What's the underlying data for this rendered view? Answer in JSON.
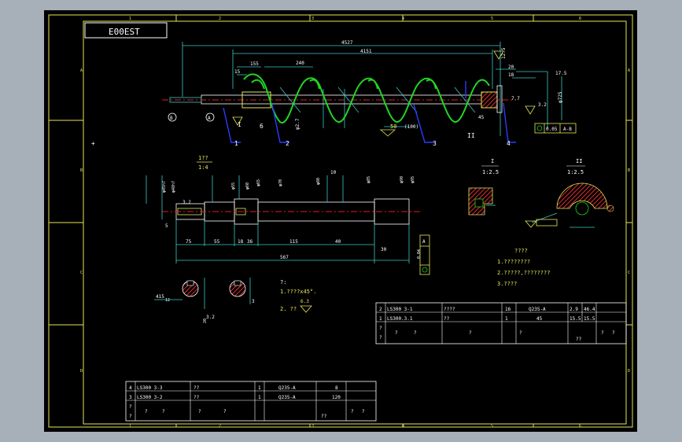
{
  "title_box": "E00EST",
  "border": {
    "top_numbers": [
      "1",
      "2",
      "3",
      "4",
      "5",
      "6"
    ],
    "bottom_numbers": [
      "1",
      "2",
      "3",
      "4",
      "5",
      "6"
    ],
    "left_letters": [
      "A",
      "B",
      "C",
      "D"
    ],
    "right_letters": [
      "A",
      "B",
      "C",
      "D"
    ]
  },
  "main_view": {
    "dims": [
      "4527",
      "4151",
      "155",
      "240",
      "15",
      "20",
      "12.5",
      "18",
      "17.5",
      "7.7",
      "3.2",
      "45",
      "φ725",
      "φ2.7"
    ],
    "labels": {
      "b": "B",
      "a": "A"
    },
    "callouts": [
      "1",
      "2",
      "3",
      "4",
      "I",
      "II",
      "6"
    ],
    "pitch": "50",
    "pitch_n": "(100)",
    "tol_value": "0.05",
    "tol_ref": "A-B"
  },
  "shaft_detail": {
    "scale_top": "1??",
    "scale_bottom": "1:4",
    "dims": [
      "75",
      "55",
      "18",
      "36",
      "115",
      "567",
      "10",
      "40",
      "30",
      "5",
      "3.2"
    ],
    "tol_value": "0.04",
    "tol_ref": "A"
  },
  "section_views": {
    "section_i_label": "I",
    "section_i_scale": "1:2.5",
    "section_ii_label": "II",
    "section_ii_scale": "1:2.5"
  },
  "small_sections": {
    "dims": [
      "415",
      "12",
      "3.2",
      "3",
      "20"
    ]
  },
  "notes_left": {
    "title": "?:",
    "line1": "1.????x45°.",
    "roughness": "6.3",
    "line2": "2. ??"
  },
  "notes_right": {
    "title": "????",
    "line1": "1.????????",
    "line2": "2.?????,????????",
    "line3": "3.????"
  },
  "bom_right": {
    "rows": [
      [
        "2",
        "LS300 3-1",
        "????",
        "16",
        "Q235-A",
        "2.9",
        "46.4"
      ],
      [
        "1",
        "LS300.3.1",
        "??",
        "1",
        "45",
        "15.5",
        "15.5"
      ],
      [
        "?",
        "?",
        "?",
        "?",
        "?",
        "?",
        "??",
        "?",
        "?"
      ]
    ]
  },
  "bom_left": {
    "rows": [
      [
        "4",
        "LS300 3-3",
        "??",
        "1",
        "Q235-A",
        "8"
      ],
      [
        "3",
        "LS300 3-2",
        "??",
        "1",
        "Q235-A",
        "120"
      ],
      [
        "?",
        "?",
        "?",
        "?",
        "?",
        "?",
        "??",
        "?",
        "?"
      ]
    ]
  },
  "colors": {
    "background": "#000000",
    "frame": "#e6e65a",
    "dimension": "#3cc8c8",
    "text": "#ffffff",
    "outline": "#ffffff",
    "spiral": "#22d422",
    "centerline": "#e02020",
    "leader": "#2a3cff",
    "annotation": "#ffe000",
    "hatch": "#e03030"
  }
}
